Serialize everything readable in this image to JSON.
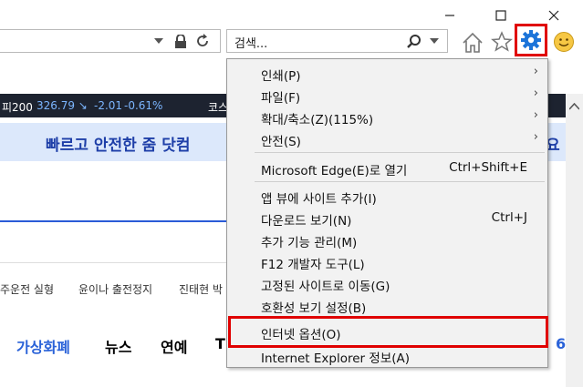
{
  "toolbar": {
    "search_placeholder": "검색...",
    "icons": [
      "lock-icon",
      "refresh-icon",
      "home-icon",
      "favorites-star-icon",
      "gear-icon",
      "smiley-icon"
    ]
  },
  "page": {
    "ticker_prefix": "피200",
    "ticker_value": "326.79 ↘",
    "ticker_change": "-2.01",
    "ticker_pct": "-0.61%",
    "ticker_right": "코스",
    "banner_text": "빠르고 안전한 줌 닷컴",
    "banner_tail": "요",
    "trending": [
      "주운전 실형",
      "윤이나 출전정지",
      "진태현 박"
    ],
    "nav": [
      "가상화폐",
      "뉴스",
      "연예",
      "T"
    ],
    "nav_tail": "6"
  },
  "menu": {
    "items": [
      {
        "label": "인쇄(P)",
        "shortcut": "",
        "submenu": true
      },
      {
        "label": "파일(F)",
        "shortcut": "",
        "submenu": true
      },
      {
        "label": "확대/축소(Z)(115%)",
        "shortcut": "",
        "submenu": true
      },
      {
        "label": "안전(S)",
        "shortcut": "",
        "submenu": true
      },
      {
        "label": "Microsoft Edge(E)로 열기",
        "shortcut": "Ctrl+Shift+E",
        "submenu": false
      },
      {
        "label": "앱 뷰에 사이트 추가(I)",
        "shortcut": "",
        "submenu": false
      },
      {
        "label": "다운로드 보기(N)",
        "shortcut": "Ctrl+J",
        "submenu": false
      },
      {
        "label": "추가 기능 관리(M)",
        "shortcut": "",
        "submenu": false
      },
      {
        "label": "F12 개발자 도구(L)",
        "shortcut": "",
        "submenu": false
      },
      {
        "label": "고정된 사이트로 이동(G)",
        "shortcut": "",
        "submenu": false
      },
      {
        "label": "호환성 보기 설정(B)",
        "shortcut": "",
        "submenu": false
      },
      {
        "label": "인터넷 옵션(O)",
        "shortcut": "",
        "submenu": false
      },
      {
        "label": "Internet Explorer 정보(A)",
        "shortcut": "",
        "submenu": false
      }
    ],
    "submenu_arrow": "›"
  },
  "colors": {
    "highlight_box": "#e00000",
    "accent_blue": "#1e3fa8"
  }
}
